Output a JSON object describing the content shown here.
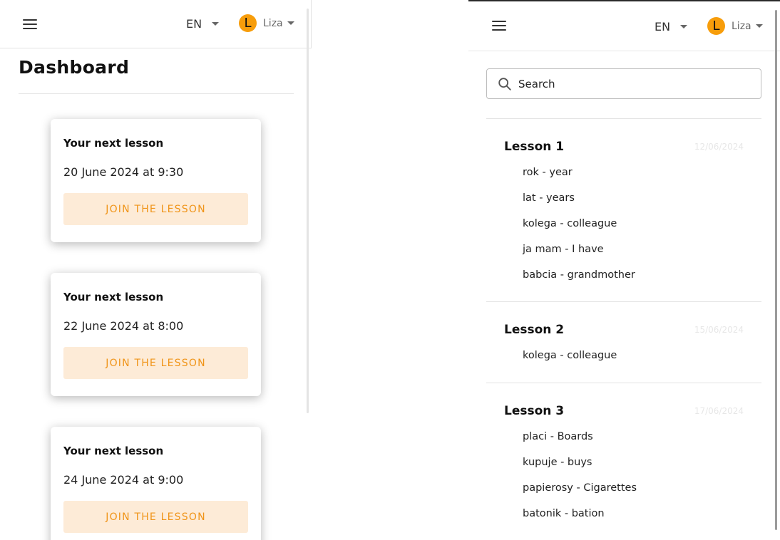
{
  "header": {
    "language": "EN",
    "user_initial": "L",
    "user_name": "Liza"
  },
  "dashboard": {
    "title": "Dashboard",
    "lessons": [
      {
        "heading": "Your next lesson",
        "date": "20 June 2024 at 9:30",
        "button": "JOIN THE LESSON"
      },
      {
        "heading": "Your next lesson",
        "date": "22 June 2024 at 8:00",
        "button": "JOIN THE LESSON"
      },
      {
        "heading": "Your next lesson",
        "date": "24 June 2024 at 9:00",
        "button": "JOIN THE LESSON"
      }
    ]
  },
  "vocabulary": {
    "search_placeholder": "Search",
    "lessons": [
      {
        "name": "Lesson 1",
        "date": "12/06/2024",
        "words": [
          "rok - year",
          "lat - years",
          "kolega - colleague",
          "ja mam - I have",
          "babcia - grandmother"
        ]
      },
      {
        "name": "Lesson 2",
        "date": "15/06/2024",
        "words": [
          "kolega - colleague"
        ]
      },
      {
        "name": "Lesson 3",
        "date": "17/06/2024",
        "words": [
          "placi - Boards",
          "kupuje - buys",
          "papierosy - Cigarettes",
          "batonik - bation"
        ]
      }
    ]
  },
  "colors": {
    "accent": "#f79d0b",
    "button_bg": "#fdebd7",
    "button_text": "#f09418"
  }
}
